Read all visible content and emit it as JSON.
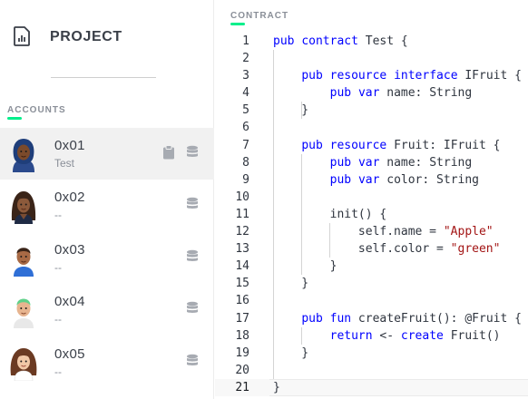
{
  "sidebar": {
    "project_title": "PROJECT",
    "project_icon": "document-chart-icon",
    "accounts_label": "ACCOUNTS",
    "accounts": [
      {
        "address": "0x01",
        "name": "Test",
        "active": true,
        "icons": [
          "clipboard-icon",
          "database-icon"
        ]
      },
      {
        "address": "0x02",
        "name": "--",
        "active": false,
        "icons": [
          "database-icon"
        ]
      },
      {
        "address": "0x03",
        "name": "--",
        "active": false,
        "icons": [
          "database-icon"
        ]
      },
      {
        "address": "0x04",
        "name": "--",
        "active": false,
        "icons": [
          "database-icon"
        ]
      },
      {
        "address": "0x05",
        "name": "--",
        "active": false,
        "icons": [
          "database-icon"
        ]
      }
    ]
  },
  "editor": {
    "label": "CONTRACT",
    "current_line": 21,
    "lines": [
      {
        "n": "1",
        "code": "pub contract Test {"
      },
      {
        "n": "2",
        "code": ""
      },
      {
        "n": "3",
        "code": "    pub resource interface IFruit {"
      },
      {
        "n": "4",
        "code": "        pub var name: String"
      },
      {
        "n": "5",
        "code": "    }"
      },
      {
        "n": "6",
        "code": ""
      },
      {
        "n": "7",
        "code": "    pub resource Fruit: IFruit {"
      },
      {
        "n": "8",
        "code": "        pub var name: String"
      },
      {
        "n": "9",
        "code": "        pub var color: String"
      },
      {
        "n": "10",
        "code": ""
      },
      {
        "n": "11",
        "code": "        init() {"
      },
      {
        "n": "12",
        "code": "            self.name = \"Apple\""
      },
      {
        "n": "13",
        "code": "            self.color = \"green\""
      },
      {
        "n": "14",
        "code": "        }"
      },
      {
        "n": "15",
        "code": "    }"
      },
      {
        "n": "16",
        "code": ""
      },
      {
        "n": "17",
        "code": "    pub fun createFruit(): @Fruit {"
      },
      {
        "n": "18",
        "code": "        return <- create Fruit()"
      },
      {
        "n": "19",
        "code": "    }"
      },
      {
        "n": "20",
        "code": ""
      },
      {
        "n": "21",
        "code": "}"
      }
    ]
  },
  "colors": {
    "accent": "#00ef8b",
    "keyword": "#0000ff",
    "string": "#a31515"
  }
}
